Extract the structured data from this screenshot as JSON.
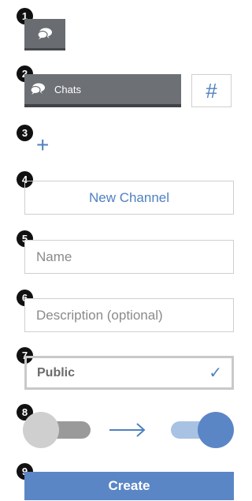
{
  "steps": [
    "1",
    "2",
    "3",
    "4",
    "5",
    "6",
    "7",
    "8",
    "9"
  ],
  "chat_icon_button": {
    "icon": "chat-bubbles-icon"
  },
  "chats_bar": {
    "icon": "chat-bubbles-icon",
    "label": "Chats"
  },
  "hash_button": {
    "label": "#"
  },
  "plus": {
    "label": "+"
  },
  "new_channel": {
    "label": "New Channel"
  },
  "name_field": {
    "placeholder": "Name",
    "value": ""
  },
  "description_field": {
    "placeholder": "Description (optional)",
    "value": ""
  },
  "privacy_select": {
    "label": "Public",
    "check": "✓"
  },
  "toggle_demo": {
    "from_state": "off",
    "to_state": "on",
    "arrow_icon": "right-arrow-icon"
  },
  "create_button": {
    "label": "Create"
  },
  "colors": {
    "accent": "#5b86c6",
    "accent_text": "#4f81c0",
    "bar": "#6d7075",
    "border": "#cfcfcf"
  }
}
